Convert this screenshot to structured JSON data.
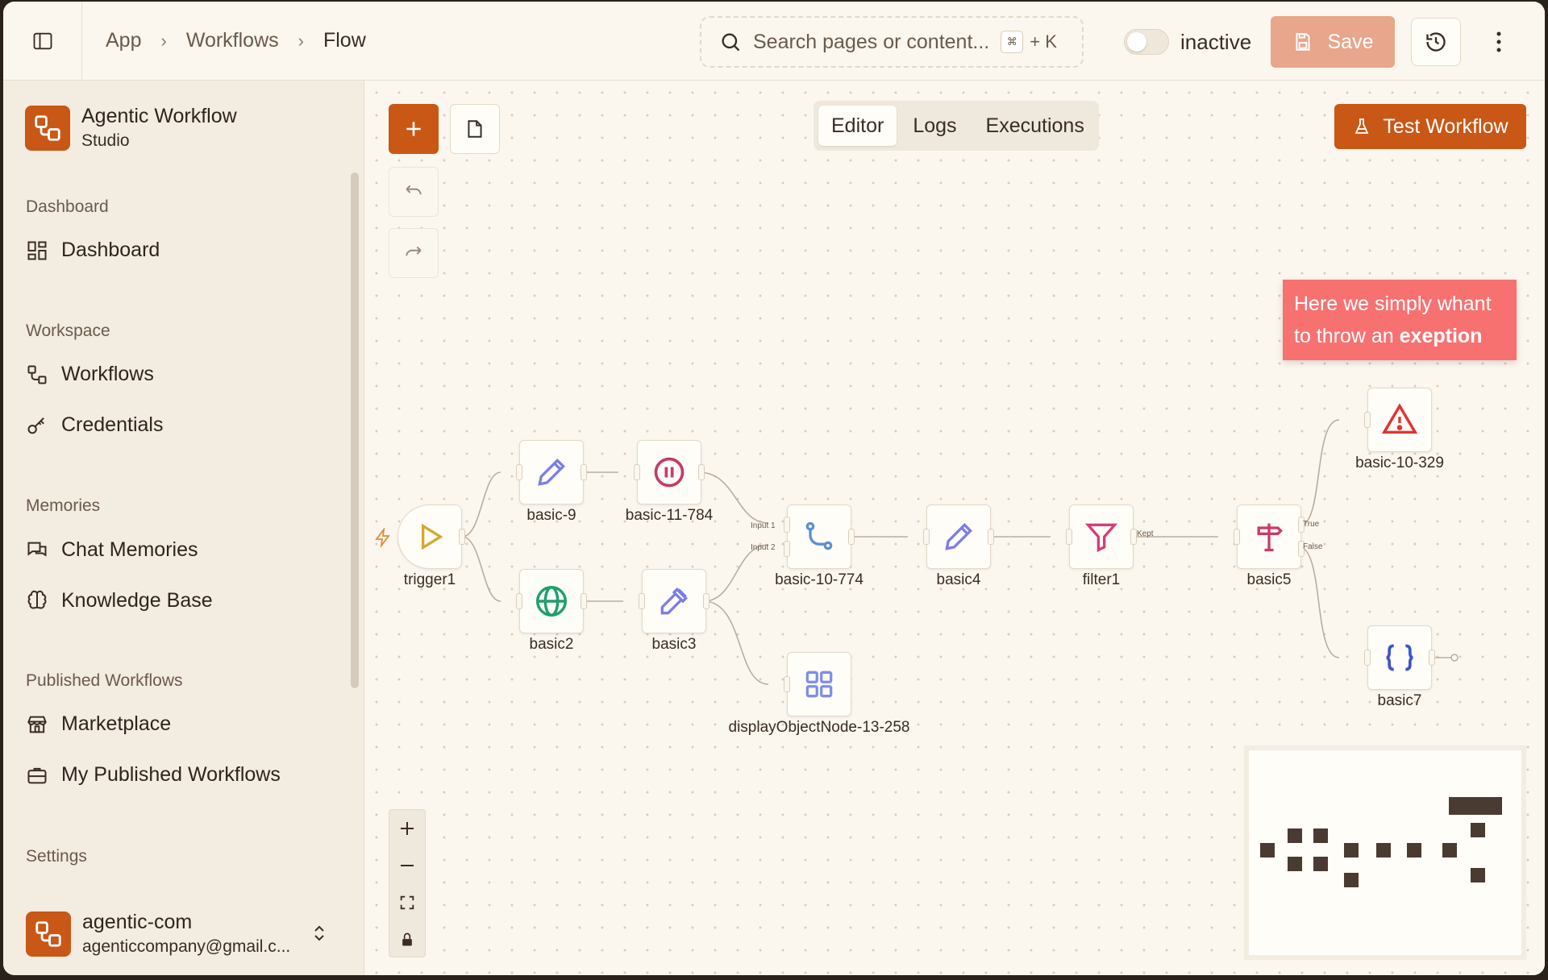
{
  "breadcrumb": [
    "App",
    "Workflows",
    "Flow"
  ],
  "search": {
    "placeholder": "Search pages or content...",
    "shortcut_key": "⌘",
    "shortcut_suffix": "+ K"
  },
  "status": {
    "label": "inactive"
  },
  "toolbar": {
    "save_label": "Save"
  },
  "brand": {
    "title": "Agentic Workflow",
    "subtitle": "Studio"
  },
  "sidebar": {
    "sections": [
      {
        "label": "Dashboard",
        "items": [
          "Dashboard"
        ]
      },
      {
        "label": "Workspace",
        "items": [
          "Workflows",
          "Credentials"
        ]
      },
      {
        "label": "Memories",
        "items": [
          "Chat Memories",
          "Knowledge Base"
        ]
      },
      {
        "label": "Published Workflows",
        "items": [
          "Marketplace",
          "My Published Workflows"
        ]
      },
      {
        "label": "Settings",
        "items": []
      }
    ]
  },
  "user": {
    "name": "agentic-com",
    "email": "agenticcompany@gmail.c..."
  },
  "tabs": [
    "Editor",
    "Logs",
    "Executions"
  ],
  "active_tab": "Editor",
  "test_button": "Test Workflow",
  "note": {
    "text_start": "Here we simply whant to throw an ",
    "text_bold": "exeption"
  },
  "nodes": [
    {
      "id": "trigger1",
      "icon": "play-icon"
    },
    {
      "id": "basic-9",
      "icon": "pencil-icon"
    },
    {
      "id": "basic-11-784",
      "icon": "pause-icon"
    },
    {
      "id": "basic2",
      "icon": "globe-icon"
    },
    {
      "id": "basic3",
      "icon": "dropper-icon"
    },
    {
      "id": "basic-10-774",
      "icon": "merge-icon"
    },
    {
      "id": "displayObjectNode-13-258",
      "icon": "grid-icon"
    },
    {
      "id": "basic4",
      "icon": "pencil-icon"
    },
    {
      "id": "filter1",
      "icon": "filter-icon"
    },
    {
      "id": "basic5",
      "icon": "signpost-icon"
    },
    {
      "id": "basic-10-329",
      "icon": "warning-icon"
    },
    {
      "id": "basic7",
      "icon": "braces-icon"
    }
  ],
  "handles": {
    "input1": "Input 1",
    "input2": "Input 2",
    "kept": "Kept",
    "true": "True",
    "false": "False"
  },
  "colors": {
    "accent": "#c95716",
    "note": "#f87171",
    "save_disabled": "#e8a68c"
  }
}
